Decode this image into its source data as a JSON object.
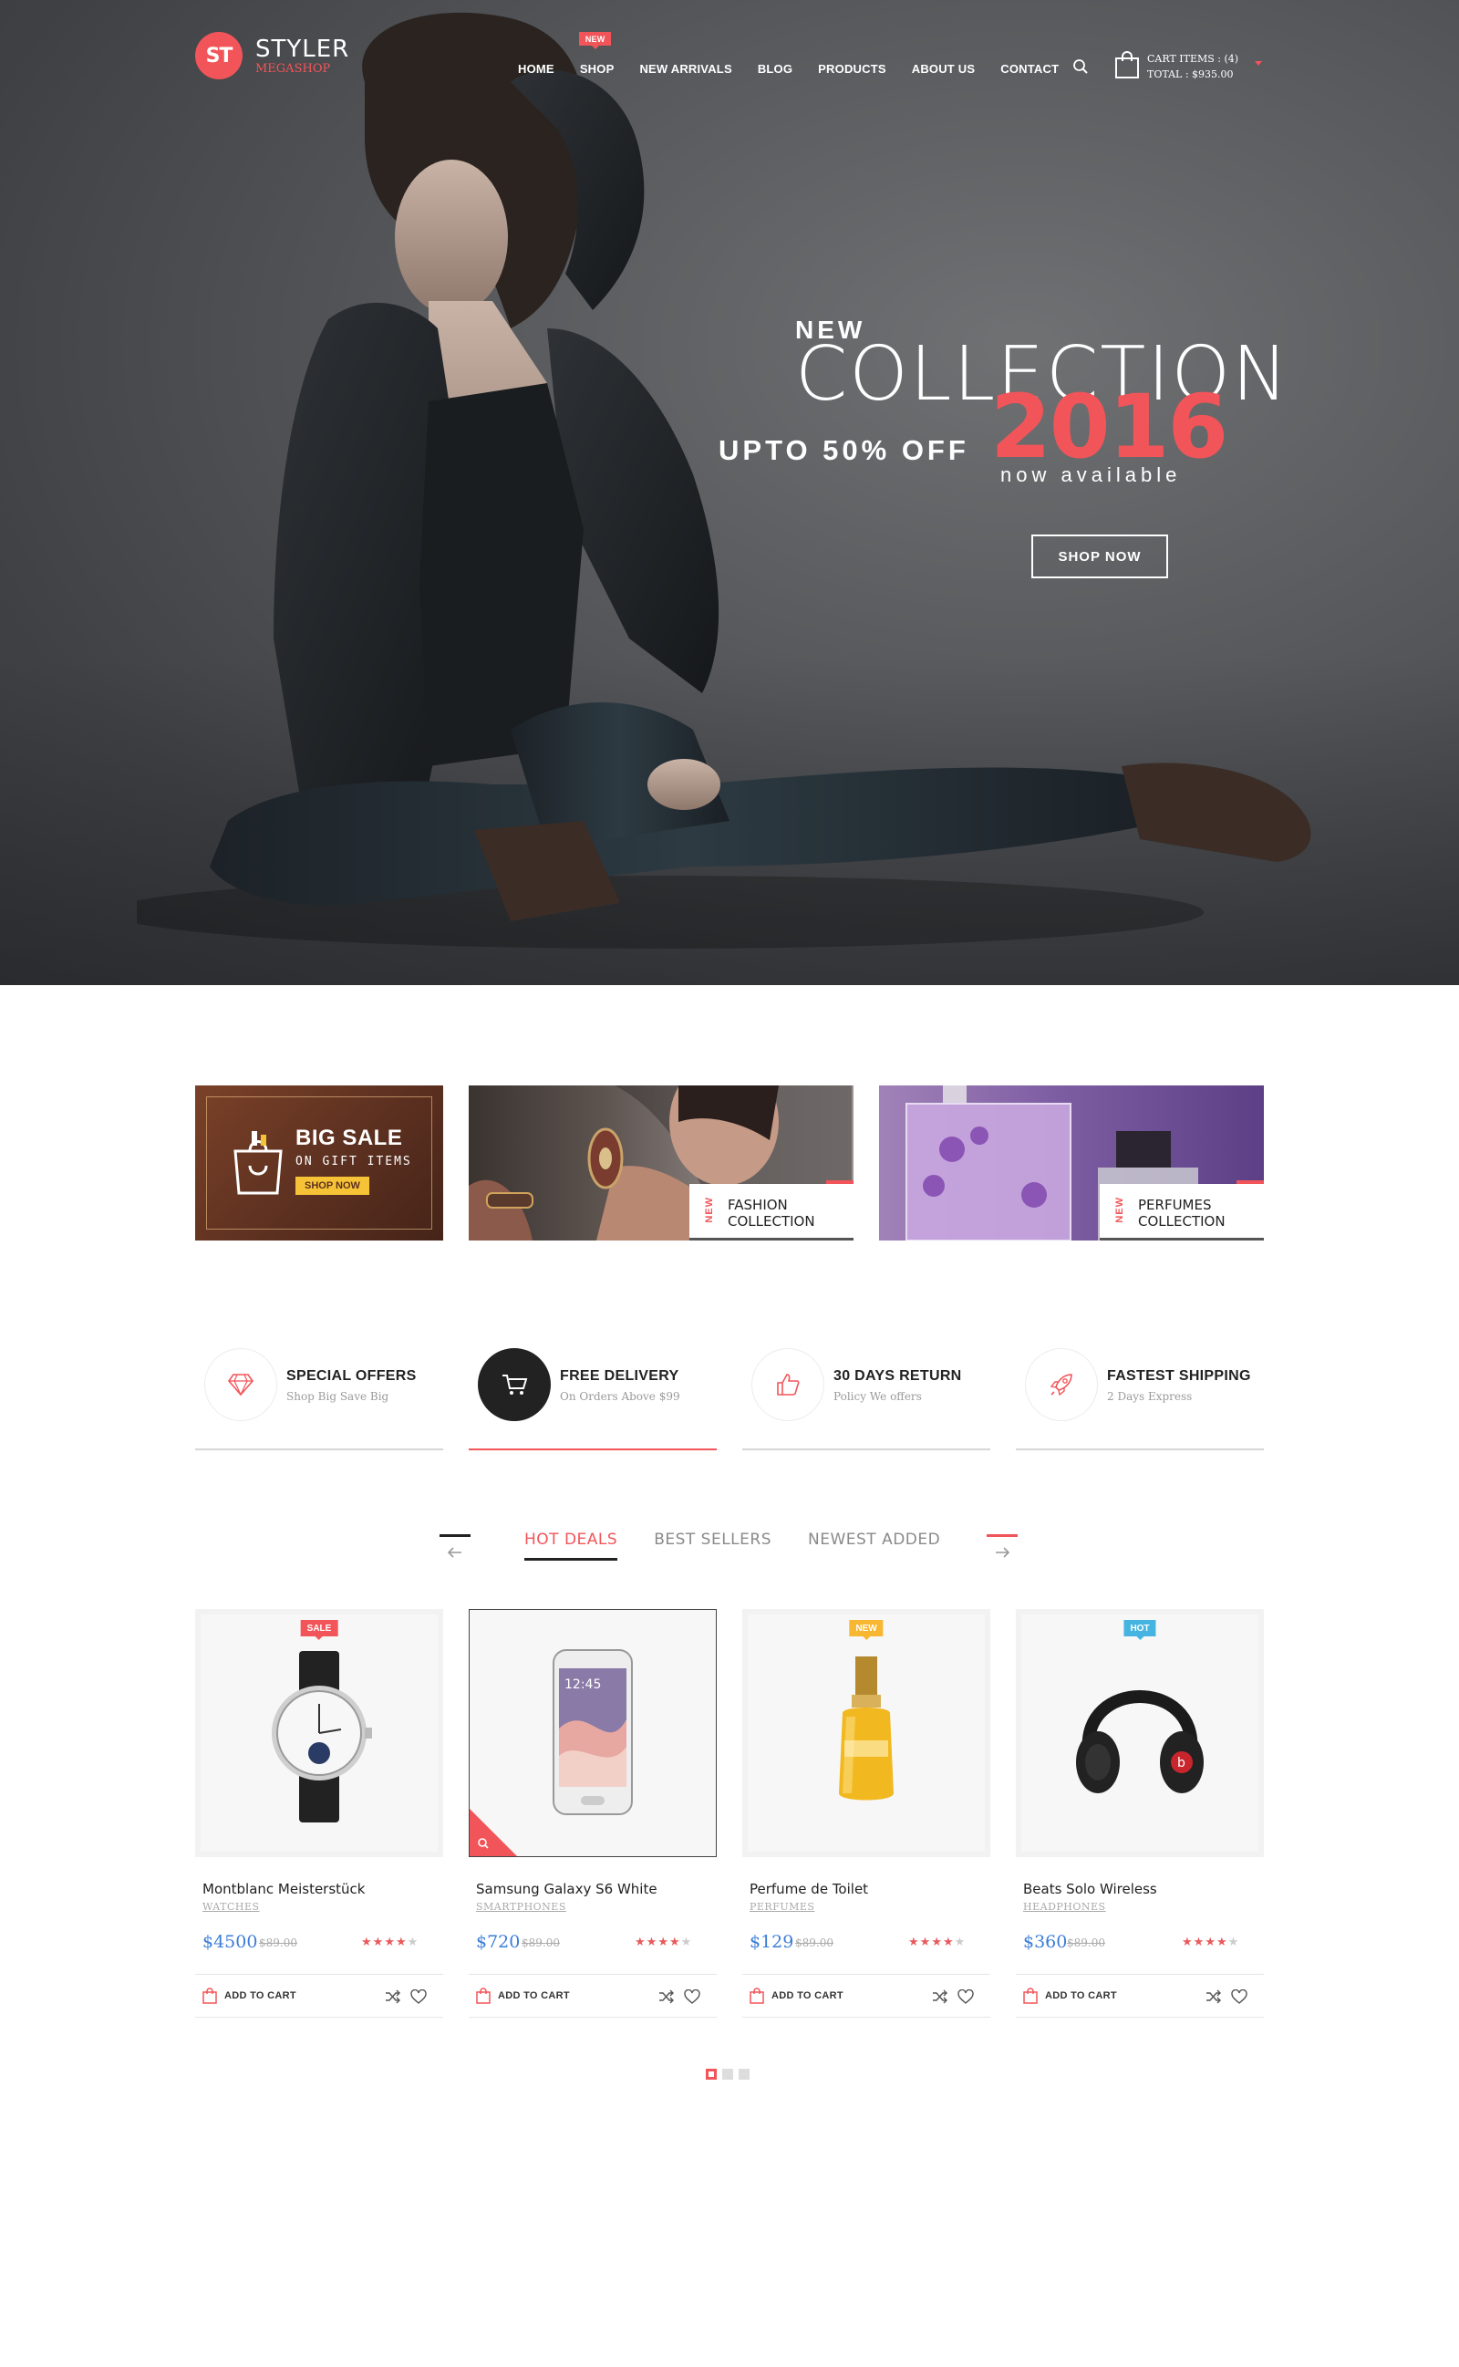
{
  "brand": {
    "logo_mark": "ST",
    "name": "STYLER",
    "tagline": "MEGASHOP",
    "accent": "#f25559"
  },
  "nav": {
    "items": [
      {
        "label": "HOME"
      },
      {
        "label": "SHOP",
        "badge": "NEW"
      },
      {
        "label": "NEW ARRIVALS"
      },
      {
        "label": "BLOG"
      },
      {
        "label": "PRODUCTS"
      },
      {
        "label": "ABOUT US"
      },
      {
        "label": "CONTACT"
      }
    ],
    "search_icon": "search-icon",
    "cart_icon": "shopping-bag-icon",
    "cart_items": "CART ITEMS : (4)",
    "cart_total": "TOTAL : $935.00"
  },
  "hero": {
    "kicker": "NEW",
    "title": "COLLECTION",
    "year": "2016",
    "offer": "UPTO 50% OFF",
    "availability": "now available",
    "cta": "SHOP NOW"
  },
  "banners": {
    "sale": {
      "title": "BIG SALE",
      "subtitle": "ON GIFT ITEMS",
      "cta": "SHOP NOW"
    },
    "fashion": {
      "tag": "NEW",
      "line1": "FASHION",
      "line2": "COLLECTION"
    },
    "perfumes": {
      "tag": "NEW",
      "line1": "PERFUMES",
      "line2": "COLLECTION"
    }
  },
  "features": [
    {
      "title": "SPECIAL OFFERS",
      "subtitle": "Shop Big Save Big",
      "icon": "diamond-icon"
    },
    {
      "title": "FREE DELIVERY",
      "subtitle": "On Orders Above $99",
      "icon": "cart-icon"
    },
    {
      "title": "30 DAYS RETURN",
      "subtitle": "Policy We offers",
      "icon": "thumbs-up-icon"
    },
    {
      "title": "FASTEST SHIPPING",
      "subtitle": "2 Days Express",
      "icon": "rocket-icon"
    }
  ],
  "tabs": [
    {
      "label": "HOT DEALS",
      "active": true
    },
    {
      "label": "BEST SELLERS",
      "active": false
    },
    {
      "label": "NEWEST ADDED",
      "active": false
    }
  ],
  "products": [
    {
      "name": "Montblanc Meisterstück",
      "category": "WATCHES",
      "price": "$4500",
      "old_price": "$89.00",
      "badge": "SALE",
      "badge_color": "#f25559",
      "rating": 4,
      "add_to_cart": "ADD TO CART"
    },
    {
      "name": "Samsung Galaxy S6 White",
      "category": "SMARTPHONES",
      "price": "$720",
      "old_price": "$89.00",
      "badge": "",
      "rating": 4,
      "add_to_cart": "ADD TO CART",
      "phone_time": "12:45"
    },
    {
      "name": "Perfume de Toilet",
      "category": "PERFUMES",
      "price": "$129",
      "old_price": "$89.00",
      "badge": "NEW",
      "badge_color": "#f7b733",
      "rating": 4,
      "add_to_cart": "ADD TO CART"
    },
    {
      "name": "Beats Solo Wireless",
      "category": "HEADPHONES",
      "price": "$360",
      "old_price": "$89.00",
      "badge": "HOT",
      "badge_color": "#45b4e0",
      "rating": 4,
      "add_to_cart": "ADD TO CART"
    }
  ],
  "pager": {
    "pages": 3,
    "current": 1
  }
}
